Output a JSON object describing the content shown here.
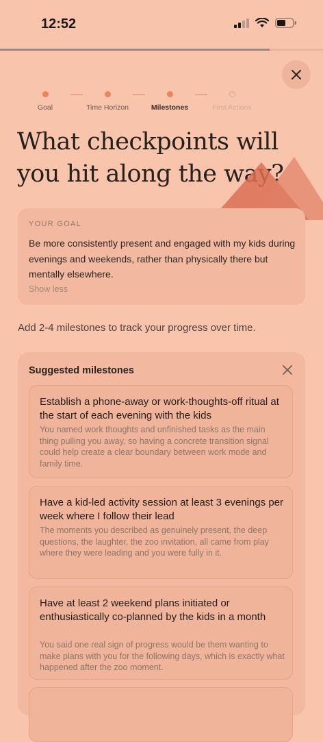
{
  "status_bar": {
    "time": "12:52"
  },
  "progress": {
    "fraction": 0.835
  },
  "stepper": {
    "steps": [
      {
        "label": "Goal",
        "state": "done"
      },
      {
        "label": "Time Horizon",
        "state": "done"
      },
      {
        "label": "Milestones",
        "state": "active"
      },
      {
        "label": "First Actions",
        "state": "todo"
      }
    ]
  },
  "page": {
    "title": "What checkpoints will you hit along the way?"
  },
  "goal": {
    "label": "YOUR GOAL",
    "text": "Be more consistently present and engaged with my kids during evenings and weekends, rather than physically there but mentally elsewhere.",
    "toggle_label": "Show less"
  },
  "instruction": "Add 2-4 milestones to track your progress over time.",
  "suggestions": {
    "title": "Suggested milestones",
    "items": [
      {
        "title": "Establish a phone-away or work-thoughts-off ritual at the start of each evening with the kids",
        "description": "You named work thoughts and unfinished tasks as the main thing pulling you away, so having a concrete transition signal could help create a clear boundary between work mode and family time."
      },
      {
        "title": "Have a kid-led activity session at least 3 evenings per week where I follow their lead",
        "description": "The moments you described as genuinely present, the deep questions, the laughter, the zoo invitation, all came from play where they were leading and you were fully in it."
      },
      {
        "title": "Have at least 2 weekend plans initiated or enthusiastically co-planned by the kids in a month",
        "description": "You said one real sign of progress would be them wanting to make plans with you for the following days, which is exactly what happened after the zoo moment."
      }
    ]
  },
  "colors": {
    "background": "#f8c5ac",
    "accent": "#ea8562",
    "card": "#f2b9a0"
  }
}
